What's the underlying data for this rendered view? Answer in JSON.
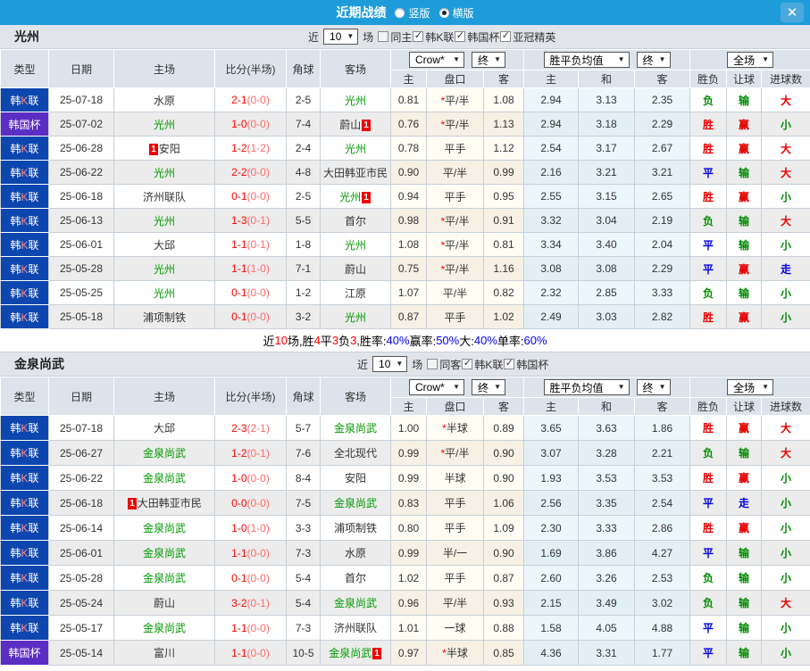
{
  "icons": {
    "chevron": "▼",
    "close": "✕"
  },
  "colors": {
    "titlebar_blue": "#1e9cd9",
    "league_k_blue": "#0c46ae",
    "cup_purple": "#5a2dc3",
    "win_red": "#e60000",
    "lose_green": "#008a00",
    "draw_blue": "#0000e0",
    "team_green": "#009900",
    "score_red": "#ff0000",
    "badge_red": "#ee0000"
  },
  "titlebar": {
    "title": "近期战绩",
    "radio_vertical": "竖版",
    "radio_horizontal": "横版"
  },
  "summary": {
    "segments": [
      {
        "t": "近"
      },
      {
        "t": "10",
        "c": "r"
      },
      {
        "t": "场,胜"
      },
      {
        "t": "4",
        "c": "r"
      },
      {
        "t": "平"
      },
      {
        "t": "3",
        "c": "r"
      },
      {
        "t": "负"
      },
      {
        "t": "3",
        "c": "r"
      },
      {
        "t": ", "
      },
      {
        "t": "胜率:"
      },
      {
        "t": "40%",
        "c": "b"
      },
      {
        "t": " 赢率:"
      },
      {
        "t": "50%",
        "c": "b"
      },
      {
        "t": " 大:"
      },
      {
        "t": "40%",
        "c": "b"
      },
      {
        "t": " 单率:"
      },
      {
        "t": "60%",
        "c": "b"
      }
    ]
  },
  "sections": [
    {
      "team": "光州",
      "filters": {
        "near": "近",
        "count": "10",
        "games": "场",
        "checks": [
          {
            "label": "同主",
            "checked": false
          },
          {
            "label": "韩K联",
            "checked": true
          },
          {
            "label": "韩国杯",
            "checked": true
          },
          {
            "label": "亚冠精英",
            "checked": true
          }
        ]
      },
      "selects": {
        "company": "Crow*",
        "final1": "终",
        "avg": "胜平负均值",
        "final2": "终",
        "scope": "全场"
      },
      "headers": {
        "type": "类型",
        "date": "日期",
        "home": "主场",
        "score": "比分(半场)",
        "corner": "角球",
        "away": "客场",
        "h": "主",
        "handicap": "盘口",
        "a": "客",
        "avg_h": "主",
        "avg_d": "和",
        "avg_a": "客",
        "wdl": "胜负",
        "let_ball": "让球",
        "goals": "进球数"
      },
      "rows": [
        {
          "lpre": "韩",
          "lk": "K",
          "lpost": "联",
          "lcls": "t-kl",
          "date": "25-07-18",
          "home": "水原",
          "ft": "2-1",
          "ht": "(0-0)",
          "cor": "2-5",
          "away": "光州",
          "acls": "green",
          "oh": "0.81",
          "star": "*",
          "hc": "平/半",
          "oa": "1.08",
          "ah": "2.94",
          "ad": "3.13",
          "aa": "2.35",
          "r1": "负",
          "r1c": "g",
          "r2": "输",
          "r2c": "g",
          "r3": "大",
          "r3c": "r"
        },
        {
          "lpre": "韩国杯",
          "lk": "",
          "lpost": "",
          "lcls": "t-cup",
          "date": "25-07-02",
          "home": "光州",
          "hcls": "green",
          "ft": "1-0",
          "ht": "(0-0)",
          "cor": "7-4",
          "away": "蔚山",
          "abpost": "1",
          "oh": "0.76",
          "star": "*",
          "hc": "平/半",
          "oa": "1.13",
          "ah": "2.94",
          "ad": "3.18",
          "aa": "2.29",
          "r1": "胜",
          "r1c": "r",
          "r2": "赢",
          "r2c": "r",
          "r3": "小",
          "r3c": "g"
        },
        {
          "lpre": "韩",
          "lk": "K",
          "lpost": "联",
          "lcls": "t-kl",
          "date": "25-06-28",
          "hbpre": "1",
          "home": "安阳",
          "ft": "1-2",
          "ht": "(1-2)",
          "cor": "2-4",
          "away": "光州",
          "acls": "green",
          "oh": "0.78",
          "star": "",
          "hc": "平手",
          "oa": "1.12",
          "ah": "2.54",
          "ad": "3.17",
          "aa": "2.67",
          "r1": "胜",
          "r1c": "r",
          "r2": "赢",
          "r2c": "r",
          "r3": "大",
          "r3c": "r"
        },
        {
          "lpre": "韩",
          "lk": "K",
          "lpost": "联",
          "lcls": "t-kl",
          "date": "25-06-22",
          "home": "光州",
          "hcls": "green",
          "ft": "2-2",
          "ht": "(0-0)",
          "cor": "4-8",
          "away": "大田韩亚市民",
          "oh": "0.90",
          "star": "",
          "hc": "平/半",
          "oa": "0.99",
          "ah": "2.16",
          "ad": "3.21",
          "aa": "3.21",
          "r1": "平",
          "r1c": "b",
          "r2": "输",
          "r2c": "g",
          "r3": "大",
          "r3c": "r"
        },
        {
          "lpre": "韩",
          "lk": "K",
          "lpost": "联",
          "lcls": "t-kl",
          "date": "25-06-18",
          "home": "济州联队",
          "ft": "0-1",
          "ht": "(0-0)",
          "cor": "2-5",
          "away": "光州",
          "acls": "green",
          "abpost": "1",
          "oh": "0.94",
          "star": "",
          "hc": "平手",
          "oa": "0.95",
          "ah": "2.55",
          "ad": "3.15",
          "aa": "2.65",
          "r1": "胜",
          "r1c": "r",
          "r2": "赢",
          "r2c": "r",
          "r3": "小",
          "r3c": "g"
        },
        {
          "lpre": "韩",
          "lk": "K",
          "lpost": "联",
          "lcls": "t-kl",
          "date": "25-06-13",
          "home": "光州",
          "hcls": "green",
          "ft": "1-3",
          "ht": "(0-1)",
          "cor": "5-5",
          "away": "首尔",
          "oh": "0.98",
          "star": "*",
          "hc": "平/半",
          "oa": "0.91",
          "ah": "3.32",
          "ad": "3.04",
          "aa": "2.19",
          "r1": "负",
          "r1c": "g",
          "r2": "输",
          "r2c": "g",
          "r3": "大",
          "r3c": "r"
        },
        {
          "lpre": "韩",
          "lk": "K",
          "lpost": "联",
          "lcls": "t-kl",
          "date": "25-06-01",
          "home": "大邱",
          "ft": "1-1",
          "ht": "(0-1)",
          "cor": "1-8",
          "away": "光州",
          "acls": "green",
          "oh": "1.08",
          "star": "*",
          "hc": "平/半",
          "oa": "0.81",
          "ah": "3.34",
          "ad": "3.40",
          "aa": "2.04",
          "r1": "平",
          "r1c": "b",
          "r2": "输",
          "r2c": "g",
          "r3": "小",
          "r3c": "g"
        },
        {
          "lpre": "韩",
          "lk": "K",
          "lpost": "联",
          "lcls": "t-kl",
          "date": "25-05-28",
          "home": "光州",
          "hcls": "green",
          "ft": "1-1",
          "ht": "(1-0)",
          "cor": "7-1",
          "away": "蔚山",
          "oh": "0.75",
          "star": "*",
          "hc": "平/半",
          "oa": "1.16",
          "ah": "3.08",
          "ad": "3.08",
          "aa": "2.29",
          "r1": "平",
          "r1c": "b",
          "r2": "赢",
          "r2c": "r",
          "r3": "走",
          "r3c": "b"
        },
        {
          "lpre": "韩",
          "lk": "K",
          "lpost": "联",
          "lcls": "t-kl",
          "date": "25-05-25",
          "home": "光州",
          "hcls": "green",
          "ft": "0-1",
          "ht": "(0-0)",
          "cor": "1-2",
          "away": "江原",
          "oh": "1.07",
          "star": "",
          "hc": "平/半",
          "oa": "0.82",
          "ah": "2.32",
          "ad": "2.85",
          "aa": "3.33",
          "r1": "负",
          "r1c": "g",
          "r2": "输",
          "r2c": "g",
          "r3": "小",
          "r3c": "g"
        },
        {
          "lpre": "韩",
          "lk": "K",
          "lpost": "联",
          "lcls": "t-kl",
          "date": "25-05-18",
          "home": "浦项制铁",
          "ft": "0-1",
          "ht": "(0-0)",
          "cor": "3-2",
          "away": "光州",
          "acls": "green",
          "oh": "0.87",
          "star": "",
          "hc": "平手",
          "oa": "1.02",
          "ah": "2.49",
          "ad": "3.03",
          "aa": "2.82",
          "r1": "胜",
          "r1c": "r",
          "r2": "赢",
          "r2c": "r",
          "r3": "小",
          "r3c": "g"
        }
      ]
    },
    {
      "team": "金泉尚武",
      "filters": {
        "near": "近",
        "count": "10",
        "games": "场",
        "checks": [
          {
            "label": "同客",
            "checked": false
          },
          {
            "label": "韩K联",
            "checked": true
          },
          {
            "label": "韩国杯",
            "checked": true
          }
        ]
      },
      "selects": {
        "company": "Crow*",
        "final1": "终",
        "avg": "胜平负均值",
        "final2": "终",
        "scope": "全场"
      },
      "headers": {
        "type": "类型",
        "date": "日期",
        "home": "主场",
        "score": "比分(半场)",
        "corner": "角球",
        "away": "客场",
        "h": "主",
        "handicap": "盘口",
        "a": "客",
        "avg_h": "主",
        "avg_d": "和",
        "avg_a": "客",
        "wdl": "胜负",
        "let_ball": "让球",
        "goals": "进球数"
      },
      "rows": [
        {
          "lpre": "韩",
          "lk": "K",
          "lpost": "联",
          "lcls": "t-kl",
          "date": "25-07-18",
          "home": "大邱",
          "ft": "2-3",
          "ht": "(2-1)",
          "cor": "5-7",
          "away": "金泉尚武",
          "acls": "green",
          "oh": "1.00",
          "star": "*",
          "hc": "半球",
          "oa": "0.89",
          "ah": "3.65",
          "ad": "3.63",
          "aa": "1.86",
          "r1": "胜",
          "r1c": "r",
          "r2": "赢",
          "r2c": "r",
          "r3": "大",
          "r3c": "r"
        },
        {
          "lpre": "韩",
          "lk": "K",
          "lpost": "联",
          "lcls": "t-kl",
          "date": "25-06-27",
          "home": "金泉尚武",
          "hcls": "green",
          "ft": "1-2",
          "ht": "(0-1)",
          "cor": "7-6",
          "away": "全北现代",
          "oh": "0.99",
          "star": "*",
          "hc": "平/半",
          "oa": "0.90",
          "ah": "3.07",
          "ad": "3.28",
          "aa": "2.21",
          "r1": "负",
          "r1c": "g",
          "r2": "输",
          "r2c": "g",
          "r3": "大",
          "r3c": "r"
        },
        {
          "lpre": "韩",
          "lk": "K",
          "lpost": "联",
          "lcls": "t-kl",
          "date": "25-06-22",
          "home": "金泉尚武",
          "hcls": "green",
          "ft": "1-0",
          "ht": "(0-0)",
          "cor": "8-4",
          "away": "安阳",
          "oh": "0.99",
          "star": "",
          "hc": "半球",
          "oa": "0.90",
          "ah": "1.93",
          "ad": "3.53",
          "aa": "3.53",
          "r1": "胜",
          "r1c": "r",
          "r2": "赢",
          "r2c": "r",
          "r3": "小",
          "r3c": "g"
        },
        {
          "lpre": "韩",
          "lk": "K",
          "lpost": "联",
          "lcls": "t-kl",
          "date": "25-06-18",
          "hbpre": "1",
          "home": "大田韩亚市民",
          "ft": "0-0",
          "ht": "(0-0)",
          "cor": "7-5",
          "away": "金泉尚武",
          "acls": "green",
          "oh": "0.83",
          "star": "",
          "hc": "平手",
          "oa": "1.06",
          "ah": "2.56",
          "ad": "3.35",
          "aa": "2.54",
          "r1": "平",
          "r1c": "b",
          "r2": "走",
          "r2c": "b",
          "r3": "小",
          "r3c": "g"
        },
        {
          "lpre": "韩",
          "lk": "K",
          "lpost": "联",
          "lcls": "t-kl",
          "date": "25-06-14",
          "home": "金泉尚武",
          "hcls": "green",
          "ft": "1-0",
          "ht": "(1-0)",
          "cor": "3-3",
          "away": "浦项制铁",
          "oh": "0.80",
          "star": "",
          "hc": "平手",
          "oa": "1.09",
          "ah": "2.30",
          "ad": "3.33",
          "aa": "2.86",
          "r1": "胜",
          "r1c": "r",
          "r2": "赢",
          "r2c": "r",
          "r3": "小",
          "r3c": "g"
        },
        {
          "lpre": "韩",
          "lk": "K",
          "lpost": "联",
          "lcls": "t-kl",
          "date": "25-06-01",
          "home": "金泉尚武",
          "hcls": "green",
          "ft": "1-1",
          "ht": "(0-0)",
          "cor": "7-3",
          "away": "水原",
          "oh": "0.99",
          "star": "",
          "hc": "半/一",
          "oa": "0.90",
          "ah": "1.69",
          "ad": "3.86",
          "aa": "4.27",
          "r1": "平",
          "r1c": "b",
          "r2": "输",
          "r2c": "g",
          "r3": "小",
          "r3c": "g"
        },
        {
          "lpre": "韩",
          "lk": "K",
          "lpost": "联",
          "lcls": "t-kl",
          "date": "25-05-28",
          "home": "金泉尚武",
          "hcls": "green",
          "ft": "0-1",
          "ht": "(0-0)",
          "cor": "5-4",
          "away": "首尔",
          "oh": "1.02",
          "star": "",
          "hc": "平手",
          "oa": "0.87",
          "ah": "2.60",
          "ad": "3.26",
          "aa": "2.53",
          "r1": "负",
          "r1c": "g",
          "r2": "输",
          "r2c": "g",
          "r3": "小",
          "r3c": "g"
        },
        {
          "lpre": "韩",
          "lk": "K",
          "lpost": "联",
          "lcls": "t-kl",
          "date": "25-05-24",
          "home": "蔚山",
          "ft": "3-2",
          "ht": "(0-1)",
          "cor": "5-4",
          "away": "金泉尚武",
          "acls": "green",
          "oh": "0.96",
          "star": "",
          "hc": "平/半",
          "oa": "0.93",
          "ah": "2.15",
          "ad": "3.49",
          "aa": "3.02",
          "r1": "负",
          "r1c": "g",
          "r2": "输",
          "r2c": "g",
          "r3": "大",
          "r3c": "r"
        },
        {
          "lpre": "韩",
          "lk": "K",
          "lpost": "联",
          "lcls": "t-kl",
          "date": "25-05-17",
          "home": "金泉尚武",
          "hcls": "green",
          "ft": "1-1",
          "ht": "(0-0)",
          "cor": "7-3",
          "away": "济州联队",
          "oh": "1.01",
          "star": "",
          "hc": "一球",
          "oa": "0.88",
          "ah": "1.58",
          "ad": "4.05",
          "aa": "4.88",
          "r1": "平",
          "r1c": "b",
          "r2": "输",
          "r2c": "g",
          "r3": "小",
          "r3c": "g"
        },
        {
          "lpre": "韩国杯",
          "lk": "",
          "lpost": "",
          "lcls": "t-cup",
          "date": "25-05-14",
          "home": "富川",
          "ft": "1-1",
          "ht": "(0-0)",
          "cor": "10-5",
          "away": "金泉尚武",
          "acls": "green",
          "abpost": "1",
          "oh": "0.97",
          "star": "*",
          "hc": "半球",
          "oa": "0.85",
          "ah": "4.36",
          "ad": "3.31",
          "aa": "1.77",
          "r1": "平",
          "r1c": "b",
          "r2": "输",
          "r2c": "g",
          "r3": "小",
          "r3c": "g"
        }
      ]
    }
  ]
}
